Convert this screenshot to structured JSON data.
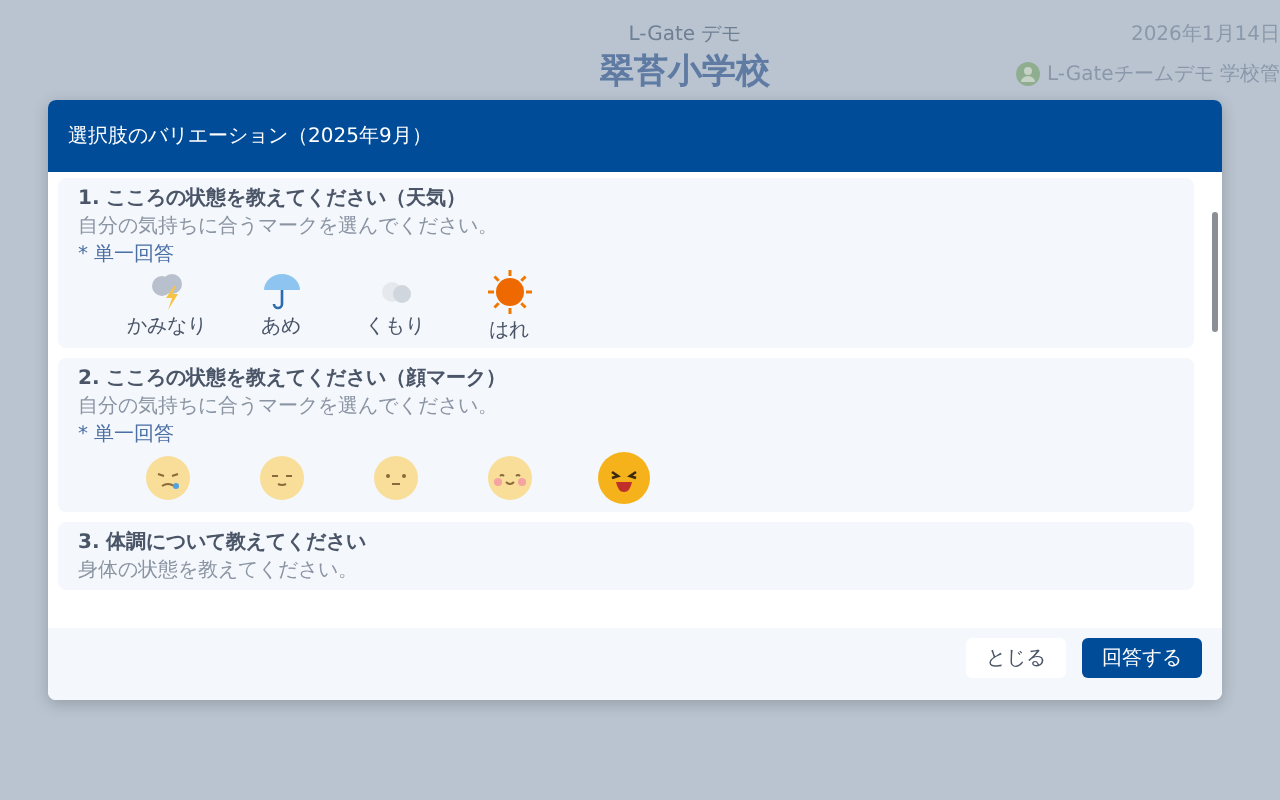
{
  "background": {
    "org": "L-Gate デモ",
    "school": "翠苔小学校",
    "date": "2026年1月14日",
    "user": "L-Gateチームデモ 学校管"
  },
  "dialog": {
    "title": "選択肢のバリエーション（2025年9月）",
    "questions": [
      {
        "title": "1. こころの状態を教えてください（天気）",
        "hint": "自分の気持ちに合うマークを選んでください。",
        "required_mark": "*",
        "required": "単一回答",
        "options": [
          {
            "kind": "thunder",
            "label": "かみなり"
          },
          {
            "kind": "rain",
            "label": "あめ"
          },
          {
            "kind": "cloud",
            "label": "くもり"
          },
          {
            "kind": "sun",
            "label": "はれ"
          }
        ]
      },
      {
        "title": "2. こころの状態を教えてください（顔マーク）",
        "hint": "自分の気持ちに合うマークを選んでください。",
        "required_mark": "*",
        "required": "単一回答",
        "options": [
          {
            "kind": "cry",
            "selected": false
          },
          {
            "kind": "sleepy",
            "selected": false
          },
          {
            "kind": "neutral",
            "selected": false
          },
          {
            "kind": "smile",
            "selected": false
          },
          {
            "kind": "laugh",
            "selected": true
          }
        ]
      },
      {
        "title": "3. 体調について教えてください",
        "hint": "身体の状態を教えてください。"
      }
    ],
    "buttons": {
      "close": "とじる",
      "submit": "回答する"
    }
  }
}
